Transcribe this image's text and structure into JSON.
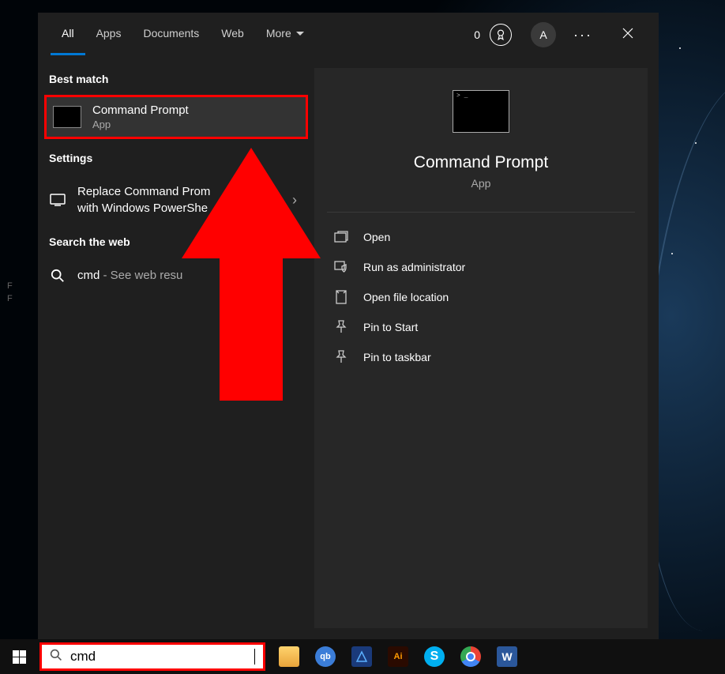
{
  "tabs": {
    "all": "All",
    "apps": "Apps",
    "documents": "Documents",
    "web": "Web",
    "more": "More"
  },
  "header": {
    "badge_count": "0",
    "avatar_initial": "A"
  },
  "sections": {
    "best_match": "Best match",
    "settings": "Settings",
    "search_web": "Search the web"
  },
  "best_match_item": {
    "title": "Command Prompt",
    "subtitle": "App"
  },
  "settings_item": {
    "line1": "Replace Command Prom",
    "line2": "with Windows PowerShe"
  },
  "web_item": {
    "query": "cmd",
    "suffix": " - See web resu"
  },
  "detail": {
    "title": "Command Prompt",
    "subtitle": "App"
  },
  "actions": {
    "open": "Open",
    "run_admin": "Run as administrator",
    "open_location": "Open file location",
    "pin_start": "Pin to Start",
    "pin_taskbar": "Pin to taskbar"
  },
  "search": {
    "value": "cmd"
  },
  "taskbar_apps": {
    "ai": "Ai"
  }
}
